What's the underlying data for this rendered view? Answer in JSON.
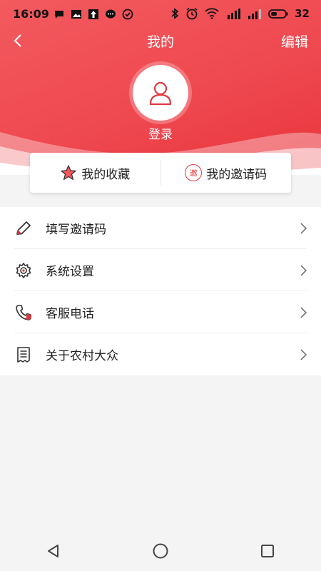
{
  "status_bar": {
    "time": "16:09",
    "battery": "32",
    "left_icons": [
      "chat-icon",
      "image-icon",
      "upload-icon",
      "message-icon",
      "check-icon"
    ],
    "right_icons": [
      "bluetooth-icon",
      "alarm-icon",
      "wifi-icon",
      "signal-icon",
      "signal-icon",
      "battery-icon"
    ]
  },
  "header": {
    "title": "我的",
    "edit_label": "编辑",
    "login_label": "登录"
  },
  "quick_actions": [
    {
      "label": "我的收藏",
      "icon": "star-icon"
    },
    {
      "label": "我的邀请码",
      "icon": "invite-icon",
      "icon_text": "邀"
    }
  ],
  "menu": [
    {
      "label": "填写邀请码",
      "icon": "pencil-icon"
    },
    {
      "label": "系统设置",
      "icon": "gear-icon"
    },
    {
      "label": "客服电话",
      "icon": "phone-icon"
    },
    {
      "label": "关于农村大众",
      "icon": "document-icon"
    }
  ],
  "colors": {
    "brand_red": "#ef4950",
    "text": "#222222",
    "background": "#f4f4f4"
  }
}
